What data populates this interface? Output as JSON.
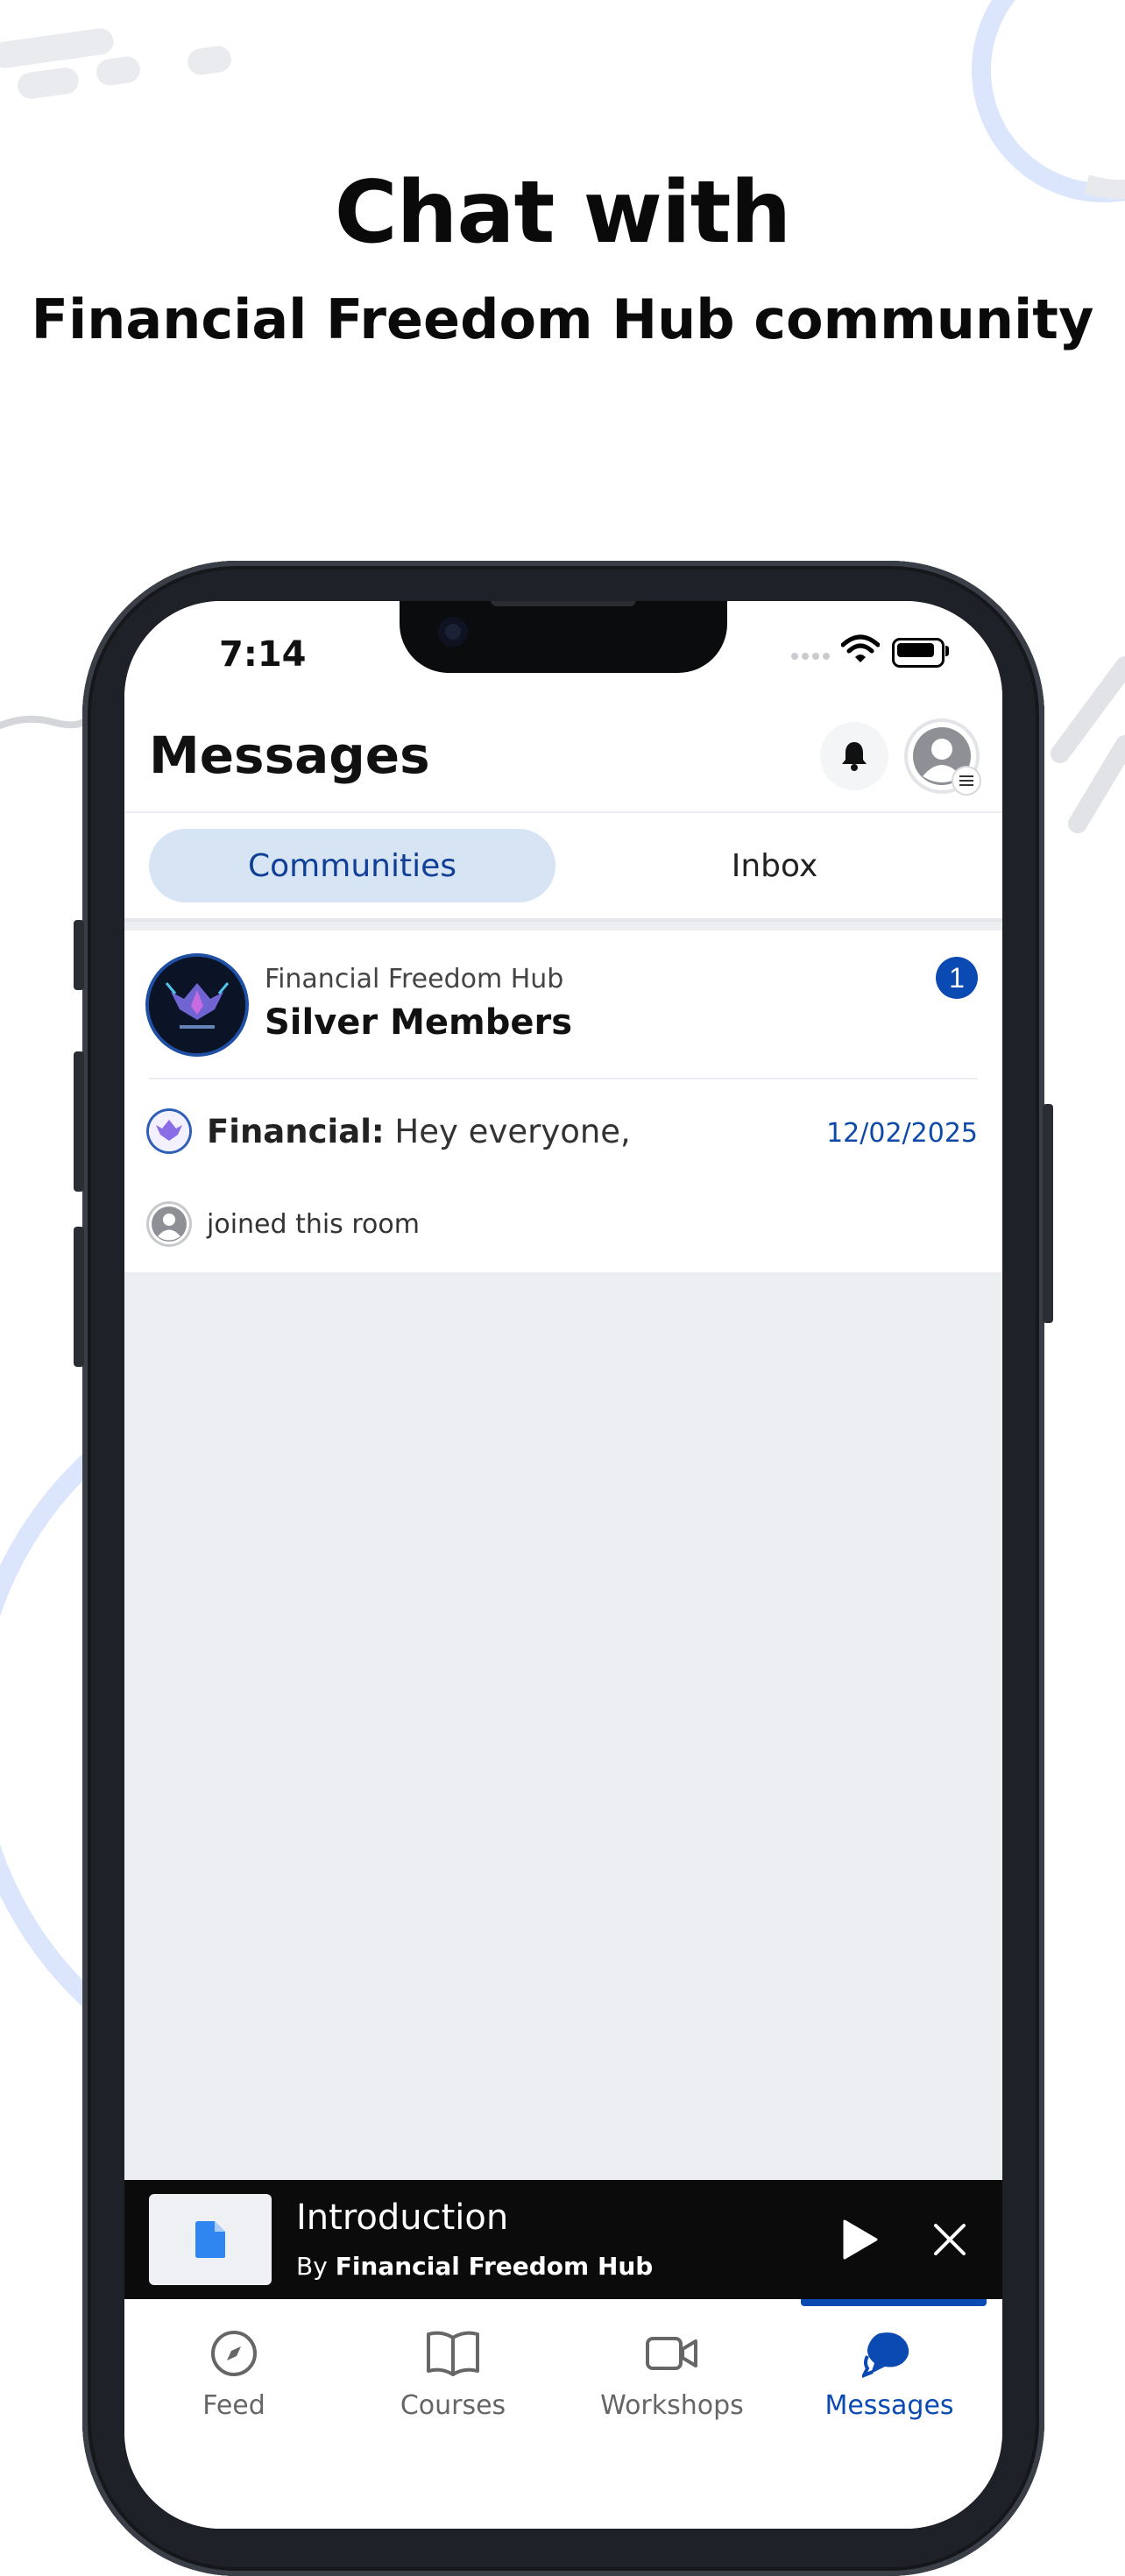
{
  "headline": {
    "line1": "Chat with",
    "line2": "Financial Freedom Hub community"
  },
  "colors": {
    "accent": "#0b4ab3",
    "tab_active_bg": "#d7e4f4",
    "decoration_ring": "#dbe6fd"
  },
  "status_bar": {
    "time": "7:14"
  },
  "header": {
    "title": "Messages",
    "notification_icon": "bell-icon",
    "profile_icon": "avatar-icon"
  },
  "tabs": [
    {
      "label": "Communities",
      "active": true
    },
    {
      "label": "Inbox",
      "active": false
    }
  ],
  "community_card": {
    "community_name": "Financial Freedom Hub",
    "room_name": "Silver Members",
    "unread_count": "1",
    "last_message": {
      "sender": "Financial:",
      "text": " Hey everyone,",
      "date": "12/02/2025"
    },
    "activity": "joined this room"
  },
  "mini_player": {
    "title": "Introduction",
    "by_prefix": "By ",
    "author": "Financial Freedom Hub",
    "thumb_icon": "document-icon",
    "play_icon": "play-icon",
    "close_icon": "close-icon"
  },
  "bottom_nav": [
    {
      "label": "Feed",
      "icon": "compass-icon",
      "active": false
    },
    {
      "label": "Courses",
      "icon": "book-icon",
      "active": false
    },
    {
      "label": "Workshops",
      "icon": "video-icon",
      "active": false
    },
    {
      "label": "Messages",
      "icon": "chat-bubbles-icon",
      "active": true
    }
  ]
}
